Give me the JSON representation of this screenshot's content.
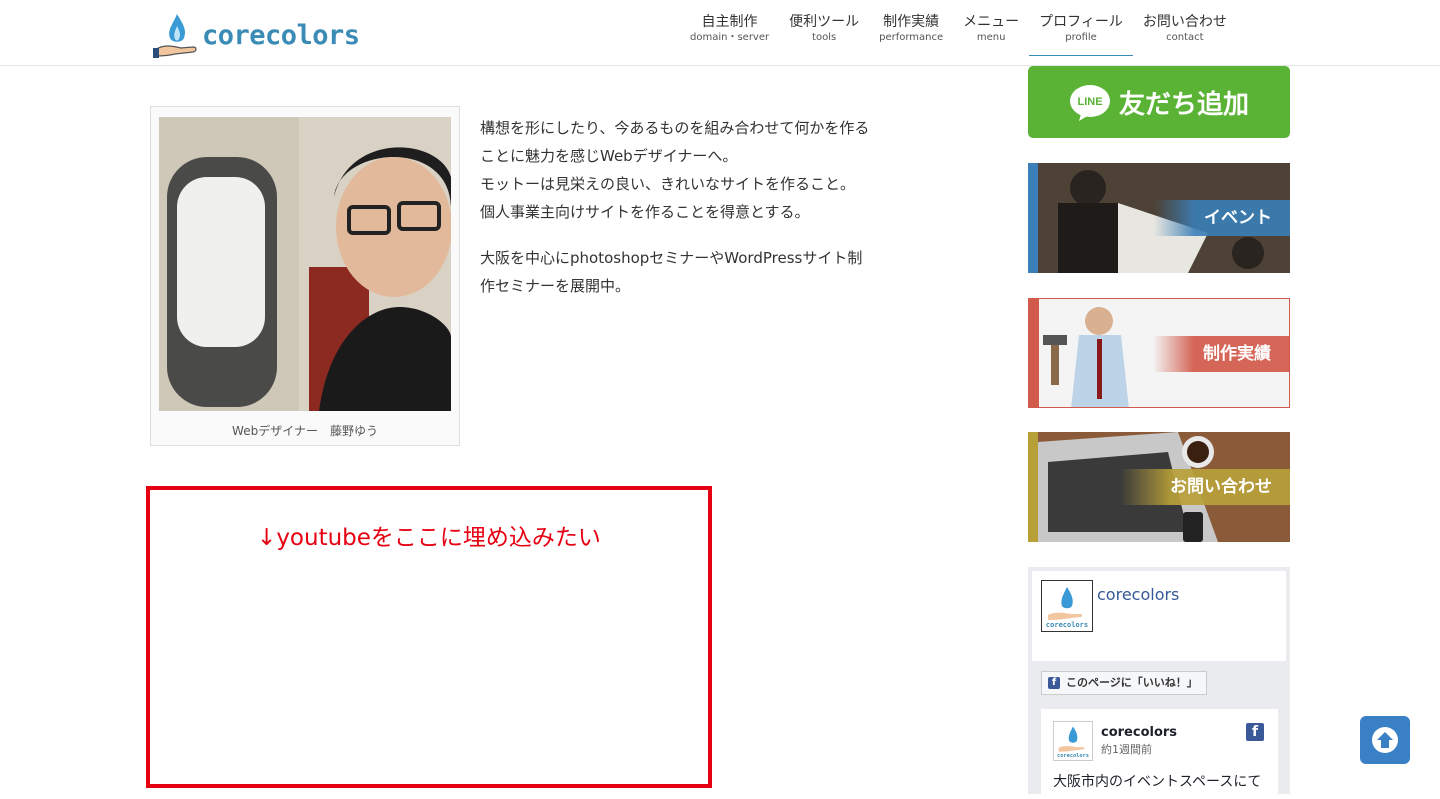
{
  "brand": {
    "name": "corecolors",
    "color": "#3a8bb5"
  },
  "nav": [
    {
      "jp": "自主制作",
      "en": "domain・server"
    },
    {
      "jp": "便利ツール",
      "en": "tools"
    },
    {
      "jp": "制作実績",
      "en": "performance"
    },
    {
      "jp": "メニュー",
      "en": "menu"
    },
    {
      "jp": "プロフィール",
      "en": "profile"
    },
    {
      "jp": "お問い合わせ",
      "en": "contact"
    }
  ],
  "profile": {
    "caption": "Webデザイナー　藤野ゆう",
    "bio1": [
      "構想を形にしたり、今あるものを組み合わせて何かを作る",
      "ことに魅力を感じWebデザイナーへ。",
      "モットーは見栄えの良い、きれいなサイトを作ること。",
      "個人事業主向けサイトを作ることを得意とする。"
    ],
    "bio2": [
      "大阪を中心にphotoshopセミナーやWordPressサイト制",
      "作セミナーを展開中。"
    ]
  },
  "youtube_note": "↓youtubeをここに埋め込みたい",
  "sidebar": {
    "line_label": "友だち追加",
    "line_logo_text": "LINE",
    "banners": [
      {
        "label": "イベント",
        "color": "#3a7fb8"
      },
      {
        "label": "制作実績",
        "color": "#d25a4a"
      },
      {
        "label": "お問い合わせ",
        "color": "#b8a039"
      }
    ]
  },
  "facebook": {
    "page_name": "corecolors",
    "like_button": "このページに「いいね！」",
    "post_name": "corecolors",
    "post_time": "約1週間前",
    "post_text": "大阪市内のイベントスペースにて"
  }
}
